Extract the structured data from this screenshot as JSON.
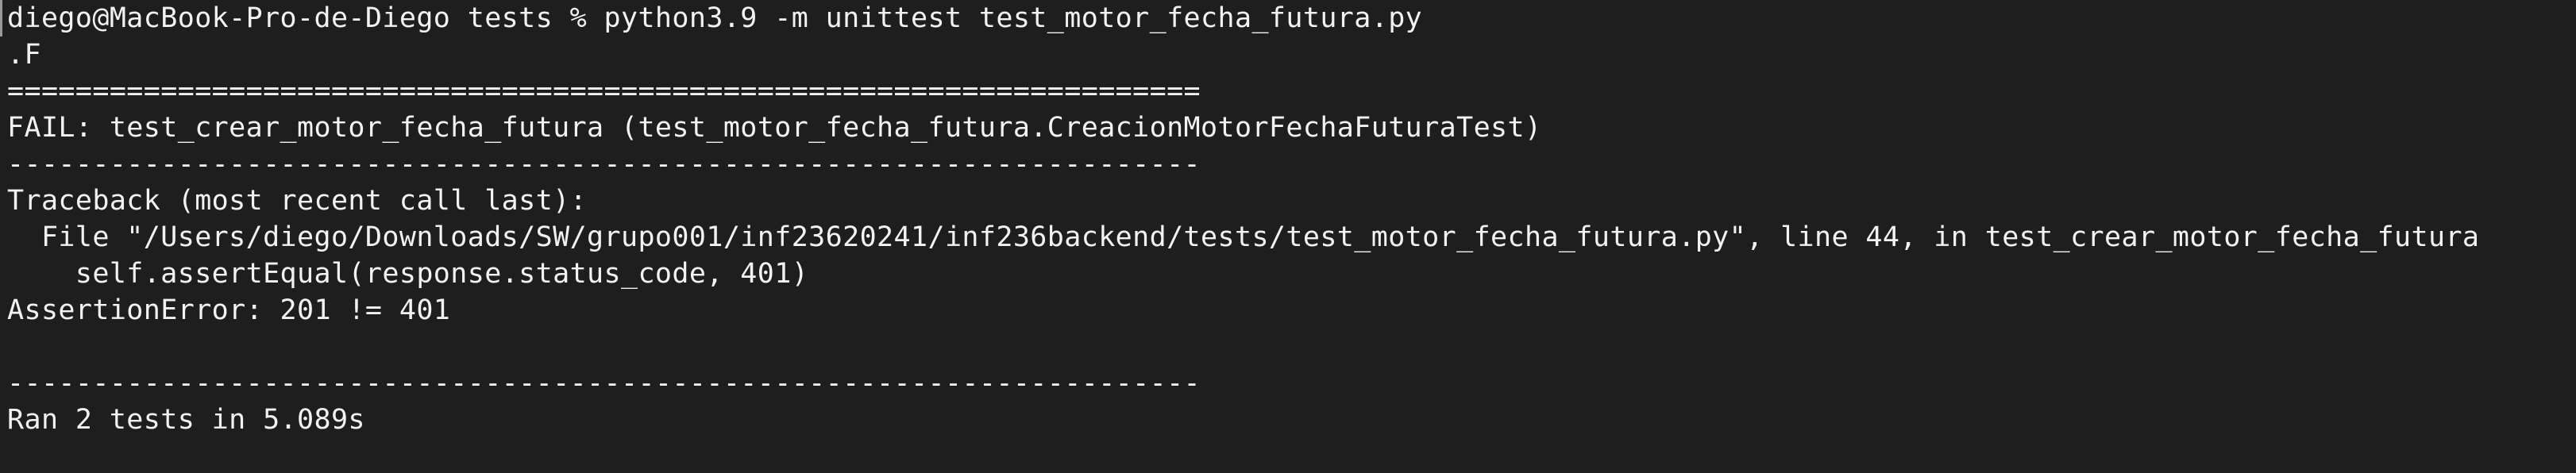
{
  "terminal": {
    "lines": [
      "diego@MacBook-Pro-de-Diego tests % python3.9 -m unittest test_motor_fecha_futura.py",
      ".F",
      "======================================================================",
      "FAIL: test_crear_motor_fecha_futura (test_motor_fecha_futura.CreacionMotorFechaFuturaTest)",
      "----------------------------------------------------------------------",
      "Traceback (most recent call last):",
      "  File \"/Users/diego/Downloads/SW/grupo001/inf23620241/inf236backend/tests/test_motor_fecha_futura.py\", line 44, in test_crear_motor_fecha_futura",
      "    self.assertEqual(response.status_code, 401)",
      "AssertionError: 201 != 401",
      "",
      "----------------------------------------------------------------------",
      "Ran 2 tests in 5.089s"
    ]
  }
}
